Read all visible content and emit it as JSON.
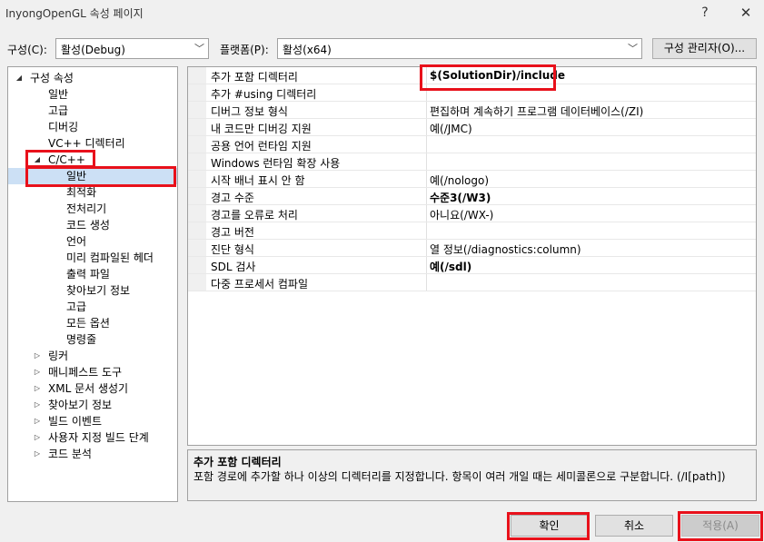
{
  "window": {
    "title": "InyongOpenGL 속성 페이지",
    "help_label": "?",
    "close_label": "✕"
  },
  "toolbar": {
    "config_label": "구성(C):",
    "config_value": "활성(Debug)",
    "platform_label": "플랫폼(P):",
    "platform_value": "활성(x64)",
    "config_manager_label": "구성 관리자(O)..."
  },
  "tree": {
    "items": [
      {
        "label": "구성 속성",
        "twisty": "◢"
      },
      {
        "label": "일반",
        "twisty": ""
      },
      {
        "label": "고급",
        "twisty": ""
      },
      {
        "label": "디버깅",
        "twisty": ""
      },
      {
        "label": "VC++ 디렉터리",
        "twisty": ""
      },
      {
        "label": "C/C++",
        "twisty": "◢"
      },
      {
        "label": "일반",
        "twisty": ""
      },
      {
        "label": "최적화",
        "twisty": ""
      },
      {
        "label": "전처리기",
        "twisty": ""
      },
      {
        "label": "코드 생성",
        "twisty": ""
      },
      {
        "label": "언어",
        "twisty": ""
      },
      {
        "label": "미리 컴파일된 헤더",
        "twisty": ""
      },
      {
        "label": "출력 파일",
        "twisty": ""
      },
      {
        "label": "찾아보기 정보",
        "twisty": ""
      },
      {
        "label": "고급",
        "twisty": ""
      },
      {
        "label": "모든 옵션",
        "twisty": ""
      },
      {
        "label": "명령줄",
        "twisty": ""
      },
      {
        "label": "링커",
        "twisty": "▷"
      },
      {
        "label": "매니페스트 도구",
        "twisty": "▷"
      },
      {
        "label": "XML 문서 생성기",
        "twisty": "▷"
      },
      {
        "label": "찾아보기 정보",
        "twisty": "▷"
      },
      {
        "label": "빌드 이벤트",
        "twisty": "▷"
      },
      {
        "label": "사용자 지정 빌드 단계",
        "twisty": "▷"
      },
      {
        "label": "코드 분석",
        "twisty": "▷"
      }
    ]
  },
  "grid": {
    "rows": [
      {
        "name": "추가 포함 디렉터리",
        "value": "$(SolutionDir)/include"
      },
      {
        "name": "추가 #using 디렉터리",
        "value": ""
      },
      {
        "name": "디버그 정보 형식",
        "value": "편집하며 계속하기 프로그램 데이터베이스(/ZI)"
      },
      {
        "name": "내 코드만 디버깅 지원",
        "value": "예(/JMC)"
      },
      {
        "name": "공용 언어 런타임 지원",
        "value": ""
      },
      {
        "name": "Windows 런타임 확장 사용",
        "value": ""
      },
      {
        "name": "시작 배너 표시 안 함",
        "value": "예(/nologo)"
      },
      {
        "name": "경고 수준",
        "value": "수준3(/W3)"
      },
      {
        "name": "경고를 오류로 처리",
        "value": "아니요(/WX-)"
      },
      {
        "name": "경고 버전",
        "value": ""
      },
      {
        "name": "진단 형식",
        "value": "열 정보(/diagnostics:column)"
      },
      {
        "name": "SDL 검사",
        "value": "예(/sdl)"
      },
      {
        "name": "다중 프로세서 컴파일",
        "value": ""
      }
    ]
  },
  "description": {
    "title": "추가 포함 디렉터리",
    "text": "포함 경로에 추가할 하나 이상의 디렉터리를 지정합니다. 항목이 여러 개일 때는 세미콜론으로 구분합니다. (/I[path])"
  },
  "buttons": {
    "ok": "확인",
    "cancel": "취소",
    "apply": "적용(A)"
  },
  "colors": {
    "highlight": "#e8111b",
    "selection": "#cce0f5"
  }
}
